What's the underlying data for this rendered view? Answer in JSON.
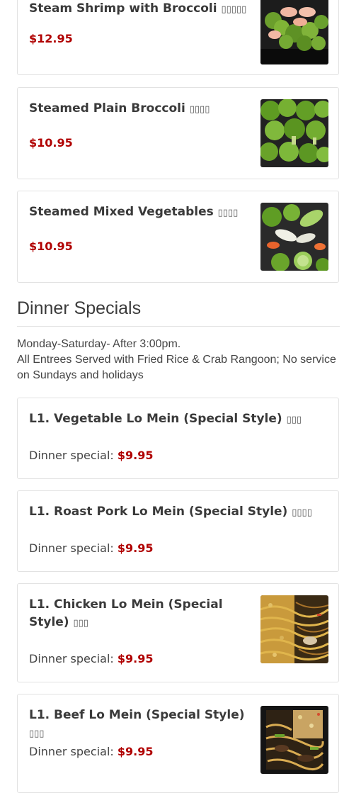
{
  "items": [
    {
      "name": "Steam Shrimp with Broccoli",
      "glyph": "▯▯▯▯▯",
      "price": "$12.95"
    },
    {
      "name": "Steamed Plain Broccoli",
      "glyph": "▯▯▯▯",
      "price": "$10.95"
    },
    {
      "name": "Steamed Mixed Vegetables",
      "glyph": "▯▯▯▯",
      "price": "$10.95"
    }
  ],
  "section": {
    "title": "Dinner Specials",
    "desc_line1": "Monday-Saturday- After 3:00pm.",
    "desc_line2": "All Entrees Served with Fried Rice & Crab Rangoon; No service on Sundays and holidays"
  },
  "specials": [
    {
      "name": "L1. Vegetable Lo Mein (Special Style)",
      "glyph": "▯▯▯",
      "label": "Dinner special:",
      "price": "$9.95"
    },
    {
      "name": "L1. Roast Pork Lo Mein (Special Style)",
      "glyph": "▯▯▯▯",
      "label": "Dinner special:",
      "price": "$9.95"
    },
    {
      "name": "L1. Chicken Lo Mein (Special Style)",
      "glyph": "▯▯▯",
      "label": "Dinner special:",
      "price": "$9.95"
    },
    {
      "name": "L1. Beef Lo Mein (Special Style)",
      "glyph": "▯▯▯",
      "label": "Dinner special:",
      "price": "$9.95"
    }
  ],
  "colors": {
    "price": "#b00000",
    "border": "#e2e2e2"
  }
}
